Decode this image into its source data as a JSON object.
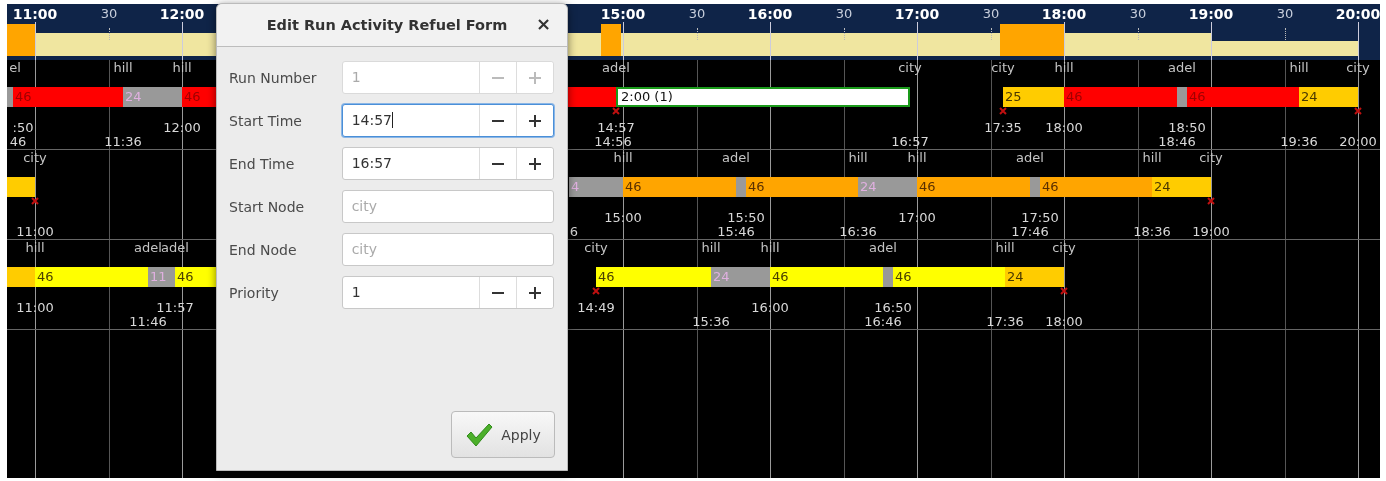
{
  "timeline": {
    "ticks": [
      {
        "label": "11:00",
        "major": true
      },
      {
        "label": "30",
        "major": false
      },
      {
        "label": "12:00",
        "major": true
      },
      {
        "label": "15:00",
        "major": true
      },
      {
        "label": "30",
        "major": false
      },
      {
        "label": "16:00",
        "major": true
      },
      {
        "label": "30",
        "major": false
      },
      {
        "label": "17:00",
        "major": true
      },
      {
        "label": "30",
        "major": false
      },
      {
        "label": "18:00",
        "major": true
      },
      {
        "label": "30",
        "major": false
      },
      {
        "label": "19:00",
        "major": true
      },
      {
        "label": "30",
        "major": false
      },
      {
        "label": "20:00",
        "major": true
      }
    ],
    "activity": [
      {
        "kind": "peak"
      },
      {
        "kind": "base"
      },
      {
        "kind": "peak"
      },
      {
        "kind": "base"
      },
      {
        "kind": "peak"
      },
      {
        "kind": "base"
      },
      {
        "kind": "low"
      }
    ],
    "rows": [
      {
        "nodes": [
          "el",
          "hill",
          "hill",
          "adel",
          "city",
          "city",
          "hill",
          "adel",
          "hill",
          "city"
        ],
        "segments": [
          {
            "color": "#999999",
            "selected": false
          },
          {
            "label": "46",
            "color": "#ff0000",
            "selected": false
          },
          {
            "label": "24",
            "color": "#999999",
            "selected": false
          },
          {
            "label": "46",
            "color": "#ff0000",
            "selected": false
          },
          {
            "label": "2:00   (1)",
            "color": "#ffffff",
            "selected": true
          },
          {
            "label": "25",
            "color": "#ffcc00",
            "selected": false
          },
          {
            "label": "46",
            "color": "#ff0000",
            "selected": false
          },
          {
            "color": "#999999",
            "selected": false
          },
          {
            "label": "46",
            "color": "#ff0000",
            "selected": false
          },
          {
            "label": "24",
            "color": "#ffcc00",
            "selected": false
          }
        ],
        "upper_times": [
          ":50",
          "12:00",
          "14:57",
          "17:35",
          "18:00",
          "18:50"
        ],
        "lower_times": [
          "46",
          "11:36",
          "14:56",
          "16:57",
          "18:46",
          "19:36",
          "20:00"
        ]
      },
      {
        "nodes": [
          "city",
          "hill",
          "adel",
          "hill",
          "hill",
          "adel",
          "hill",
          "city"
        ],
        "segments": [
          {
            "color": "#ffcc00",
            "selected": false
          },
          {
            "label": "4",
            "color": "#999999",
            "selected": false
          },
          {
            "label": "46",
            "color": "#ffa500",
            "selected": false
          },
          {
            "color": "#999999",
            "selected": false
          },
          {
            "label": "46",
            "color": "#ffa500",
            "selected": false
          },
          {
            "label": "24",
            "color": "#999999",
            "selected": false
          },
          {
            "label": "46",
            "color": "#ffa500",
            "selected": false
          },
          {
            "color": "#999999",
            "selected": false
          },
          {
            "label": "46",
            "color": "#ffa500",
            "selected": false
          },
          {
            "label": "24",
            "color": "#ffcc00",
            "selected": false
          }
        ],
        "upper_times": [
          "15:00",
          "15:50",
          "17:00",
          "17:50"
        ],
        "lower_times": [
          "11:00",
          "6",
          "15:46",
          "16:36",
          "17:46",
          "18:36",
          "19:00"
        ]
      },
      {
        "nodes": [
          "hill",
          "adel",
          "adel",
          "city",
          "hill",
          "hill",
          "adel",
          "hill",
          "city"
        ],
        "segments": [
          {
            "color": "#ffcc00",
            "selected": false
          },
          {
            "label": "46",
            "color": "#ffff00",
            "selected": false
          },
          {
            "label": "11",
            "color": "#999999",
            "selected": false
          },
          {
            "label": "46",
            "color": "#ffff00",
            "selected": false
          },
          {
            "label": "46",
            "color": "#ffff00",
            "selected": false
          },
          {
            "label": "24",
            "color": "#999999",
            "selected": false
          },
          {
            "label": "46",
            "color": "#ffff00",
            "selected": false
          },
          {
            "color": "#999999",
            "selected": false
          },
          {
            "label": "46",
            "color": "#ffff00",
            "selected": false
          },
          {
            "label": "24",
            "color": "#ffcc00",
            "selected": false
          }
        ],
        "upper_times": [
          "11:00",
          "11:57",
          "14:49",
          "16:00",
          "16:50"
        ],
        "lower_times": [
          "11:46",
          "15:36",
          "16:46",
          "17:36",
          "18:00"
        ]
      }
    ]
  },
  "dialog": {
    "title": "Edit Run Activity Refuel Form",
    "close": "×",
    "fields": [
      {
        "label": "Run Number",
        "kind": "spin",
        "value": "1",
        "disabled": true,
        "focused": false
      },
      {
        "label": "Start Time",
        "kind": "spin",
        "value": "14:57",
        "disabled": false,
        "focused": true
      },
      {
        "label": "End Time",
        "kind": "spin",
        "value": "16:57",
        "disabled": false,
        "focused": false
      },
      {
        "label": "Start Node",
        "kind": "text",
        "placeholder": "city",
        "disabled": false,
        "focused": false
      },
      {
        "label": "End Node",
        "kind": "text",
        "placeholder": "city",
        "disabled": false,
        "focused": false
      },
      {
        "label": "Priority",
        "kind": "spin",
        "value": "1",
        "disabled": false,
        "focused": false
      }
    ],
    "apply": {
      "label": "Apply"
    }
  }
}
